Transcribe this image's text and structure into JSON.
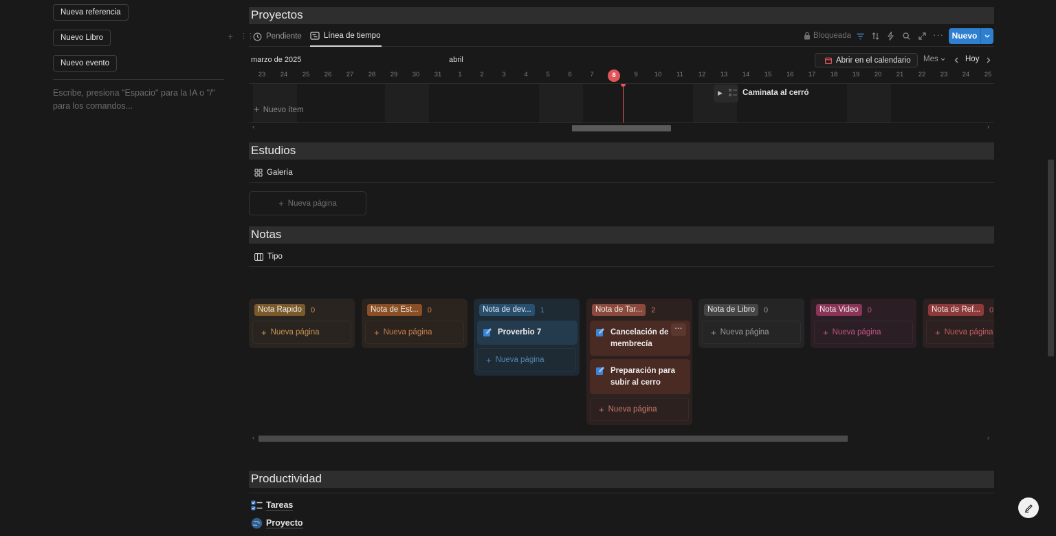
{
  "sidebar": {
    "buttons": [
      "Nueva referencia",
      "Nuevo Libro",
      "Nuevo evento"
    ],
    "placeholder": "Escribe, presiona \"Espacio\" para la IA o \"/\" para los comandos..."
  },
  "proyectos": {
    "title": "Proyectos",
    "tabs": [
      "Pendiente",
      "Línea de tiempo"
    ],
    "locked_label": "Bloqueada",
    "new_label": "Nuevo",
    "timeline": {
      "month_label": "marzo de 2025",
      "month_label_2": "abril",
      "open_calendar": "Abrir en el calendario",
      "scale": "Mes",
      "today": "Hoy",
      "days": [
        "23",
        "24",
        "25",
        "26",
        "27",
        "28",
        "29",
        "30",
        "31",
        "1",
        "2",
        "3",
        "4",
        "5",
        "6",
        "7",
        "8",
        "9",
        "10",
        "11",
        "12",
        "13",
        "14",
        "15",
        "16",
        "17",
        "18",
        "19",
        "20",
        "21",
        "22",
        "23",
        "24",
        "25"
      ],
      "today_index": 16,
      "item": "Caminata al cerró",
      "new_item": "Nuevo ítem"
    }
  },
  "estudios": {
    "title": "Estudios",
    "view": "Galería",
    "new_page": "Nueva página"
  },
  "notas": {
    "title": "Notas",
    "view": "Tipo",
    "columns": [
      {
        "label": "Nota Rapido",
        "count": "0",
        "new": "Nueva página",
        "tag": "#7a5a2a",
        "bg": "#2a2420",
        "text": "#c79455"
      },
      {
        "label": "Nota de Est...",
        "count": "0",
        "new": "Nueva página",
        "tag": "#8a4f25",
        "bg": "#2b231d",
        "text": "#c9804e"
      },
      {
        "label": "Nota de dev...",
        "count": "1",
        "new": "Nueva página",
        "tag": "#28506e",
        "bg": "#1e2a34",
        "text": "#4f86b0",
        "cards": [
          "Proverbio 7"
        ]
      },
      {
        "label": "Nota de Tar...",
        "count": "2",
        "new": "Nueva página",
        "tag": "#8b4a3c",
        "bg": "#2d2120",
        "text": "#c97a69",
        "cards": [
          "Cancelación de membrecía",
          "Preparación para subir al cerro"
        ]
      },
      {
        "label": "Nota de Libro",
        "count": "0",
        "new": "Nueva página",
        "tag": "#454545",
        "bg": "#252525",
        "text": "#9b9b9b"
      },
      {
        "label": "Nota Video",
        "count": "0",
        "new": "Nueva página",
        "tag": "#8a3556",
        "bg": "#2b1f25",
        "text": "#c0577f"
      },
      {
        "label": "Nota de Ref...",
        "count": "0",
        "new": "Nueva página",
        "tag": "#8d3a3a",
        "bg": "#2d2020",
        "text": "#c25f5f"
      }
    ]
  },
  "productividad": {
    "title": "Productividad",
    "links": [
      "Tareas",
      "Proyecto"
    ]
  },
  "colors": {
    "accent": "#2f7fd1",
    "today": "#e0555a"
  }
}
